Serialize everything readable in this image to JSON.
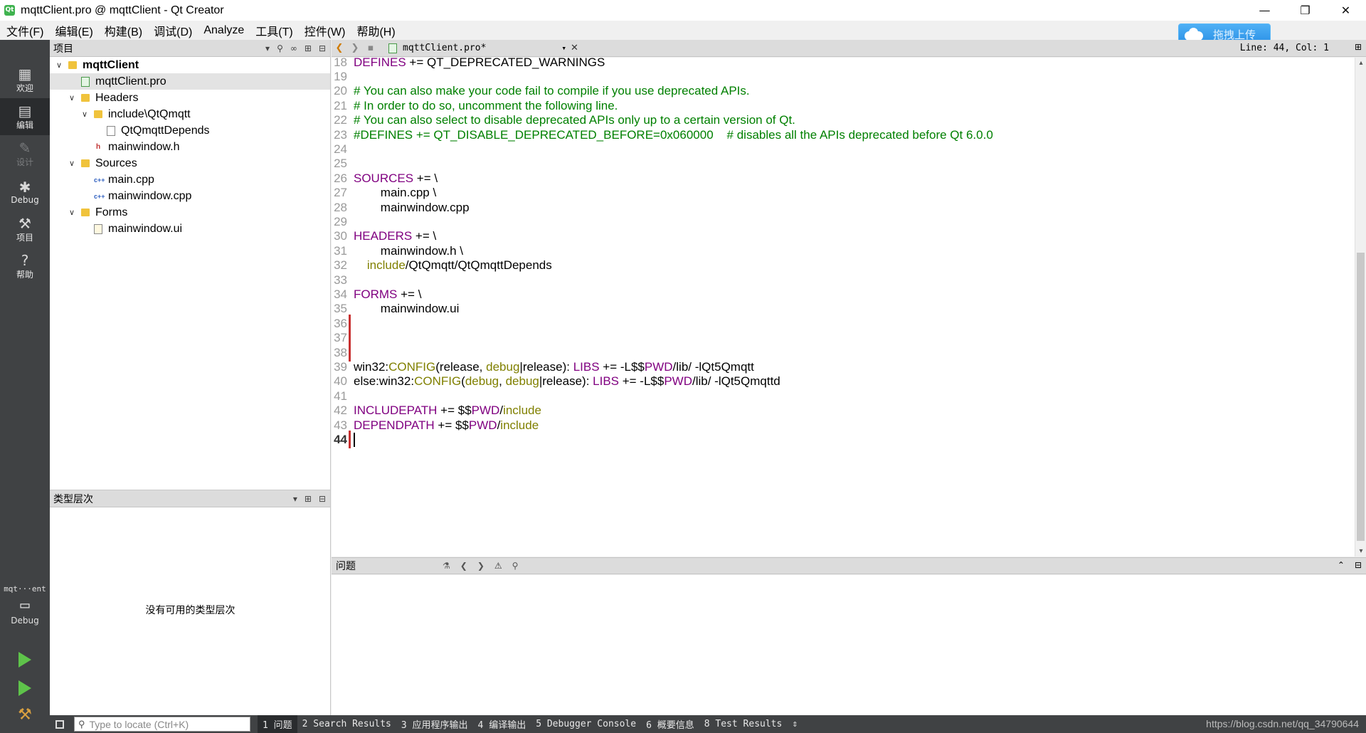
{
  "window": {
    "title": "mqttClient.pro @ mqttClient - Qt Creator",
    "app_icon": "qt-creator-icon",
    "minimize": "—",
    "restore": "❐",
    "close": "✕"
  },
  "menu": [
    "文件(F)",
    "编辑(E)",
    "构建(B)",
    "调试(D)",
    "Analyze",
    "工具(T)",
    "控件(W)",
    "帮助(H)"
  ],
  "upload_button": {
    "label": "拖拽上传",
    "icon": "cloud-icon"
  },
  "modes": {
    "welcome": "欢迎",
    "edit": "编辑",
    "design": "设计",
    "debug": "Debug",
    "projects": "项目",
    "help": "帮助"
  },
  "kit": {
    "project": "mqt···ent",
    "config": "Debug"
  },
  "project_pane": {
    "title": "项目",
    "tree": [
      {
        "label": "mqttClient",
        "level": 0,
        "expand": "v",
        "icon": "project-folder",
        "bold": true
      },
      {
        "label": "mqttClient.pro",
        "level": 1,
        "expand": "",
        "icon": "pro-file",
        "selected": true
      },
      {
        "label": "Headers",
        "level": 1,
        "expand": "v",
        "icon": "folder"
      },
      {
        "label": "include\\QtQmqtt",
        "level": 2,
        "expand": "v",
        "icon": "folder"
      },
      {
        "label": "QtQmqttDepends",
        "level": 3,
        "expand": "",
        "icon": "file"
      },
      {
        "label": "mainwindow.h",
        "level": 2,
        "expand": "",
        "icon": "header-file"
      },
      {
        "label": "Sources",
        "level": 1,
        "expand": "v",
        "icon": "folder"
      },
      {
        "label": "main.cpp",
        "level": 2,
        "expand": "",
        "icon": "cpp-file"
      },
      {
        "label": "mainwindow.cpp",
        "level": 2,
        "expand": "",
        "icon": "cpp-file"
      },
      {
        "label": "Forms",
        "level": 1,
        "expand": "v",
        "icon": "folder"
      },
      {
        "label": "mainwindow.ui",
        "level": 2,
        "expand": "",
        "icon": "ui-file"
      }
    ]
  },
  "hierarchy_pane": {
    "title": "类型层次",
    "empty_text": "没有可用的类型层次"
  },
  "editor": {
    "document": "mqttClient.pro*",
    "cursor_info": "Line: 44, Col: 1",
    "lines": [
      {
        "n": "18",
        "parts": [
          [
            "var",
            "DEFINES"
          ],
          [
            "txt",
            " += QT_DEPRECATED_WARNINGS"
          ]
        ]
      },
      {
        "n": "19",
        "parts": []
      },
      {
        "n": "20",
        "parts": [
          [
            "comment",
            "# You can also make your code fail to compile if you use deprecated APIs."
          ]
        ]
      },
      {
        "n": "21",
        "parts": [
          [
            "comment",
            "# In order to do so, uncomment the following line."
          ]
        ]
      },
      {
        "n": "22",
        "parts": [
          [
            "comment",
            "# You can also select to disable deprecated APIs only up to a certain version of Qt."
          ]
        ]
      },
      {
        "n": "23",
        "parts": [
          [
            "comment",
            "#DEFINES += QT_DISABLE_DEPRECATED_BEFORE=0x060000    # disables all the APIs deprecated before Qt 6.0.0"
          ]
        ]
      },
      {
        "n": "24",
        "parts": []
      },
      {
        "n": "25",
        "parts": []
      },
      {
        "n": "26",
        "parts": [
          [
            "var",
            "SOURCES"
          ],
          [
            "txt",
            " += \\"
          ]
        ]
      },
      {
        "n": "27",
        "parts": [
          [
            "txt",
            "        main.cpp \\"
          ]
        ]
      },
      {
        "n": "28",
        "parts": [
          [
            "txt",
            "        mainwindow.cpp"
          ]
        ]
      },
      {
        "n": "29",
        "parts": []
      },
      {
        "n": "30",
        "parts": [
          [
            "var",
            "HEADERS"
          ],
          [
            "txt",
            " += \\"
          ]
        ]
      },
      {
        "n": "31",
        "parts": [
          [
            "txt",
            "        mainwindow.h \\"
          ]
        ]
      },
      {
        "n": "32",
        "parts": [
          [
            "txt",
            "    "
          ],
          [
            "fn",
            "include"
          ],
          [
            "txt",
            "/QtQmqtt/QtQmqttDepends"
          ]
        ]
      },
      {
        "n": "33",
        "parts": []
      },
      {
        "n": "34",
        "parts": [
          [
            "var",
            "FORMS"
          ],
          [
            "txt",
            " += \\"
          ]
        ]
      },
      {
        "n": "35",
        "parts": [
          [
            "txt",
            "        mainwindow.ui"
          ]
        ]
      },
      {
        "n": "36",
        "parts": [],
        "modified": true
      },
      {
        "n": "37",
        "parts": [],
        "modified": true
      },
      {
        "n": "38",
        "parts": [],
        "modified": true
      },
      {
        "n": "39",
        "parts": [
          [
            "txt",
            "win32:"
          ],
          [
            "fn",
            "CONFIG"
          ],
          [
            "txt",
            "(release, "
          ],
          [
            "fn",
            "debug"
          ],
          [
            "txt",
            "|release): "
          ],
          [
            "var",
            "LIBS"
          ],
          [
            "txt",
            " += -L$$"
          ],
          [
            "var",
            "PWD"
          ],
          [
            "txt",
            "/lib/ -lQt5Qmqtt"
          ]
        ]
      },
      {
        "n": "40",
        "parts": [
          [
            "txt",
            "else:win32:"
          ],
          [
            "fn",
            "CONFIG"
          ],
          [
            "txt",
            "("
          ],
          [
            "fn",
            "debug"
          ],
          [
            "txt",
            ", "
          ],
          [
            "fn",
            "debug"
          ],
          [
            "txt",
            "|release): "
          ],
          [
            "var",
            "LIBS"
          ],
          [
            "txt",
            " += -L$$"
          ],
          [
            "var",
            "PWD"
          ],
          [
            "txt",
            "/lib/ -lQt5Qmqttd"
          ]
        ]
      },
      {
        "n": "41",
        "parts": []
      },
      {
        "n": "42",
        "parts": [
          [
            "var",
            "INCLUDEPATH"
          ],
          [
            "txt",
            " += $$"
          ],
          [
            "var",
            "PWD"
          ],
          [
            "txt",
            "/"
          ],
          [
            "fn",
            "include"
          ]
        ]
      },
      {
        "n": "43",
        "parts": [
          [
            "var",
            "DEPENDPATH"
          ],
          [
            "txt",
            " += $$"
          ],
          [
            "var",
            "PWD"
          ],
          [
            "txt",
            "/"
          ],
          [
            "fn",
            "include"
          ]
        ]
      },
      {
        "n": "44",
        "parts": [],
        "current": true,
        "modified": true
      }
    ]
  },
  "issues_pane": {
    "title": "问题"
  },
  "statusbar": {
    "locator_placeholder": "Type to locate (Ctrl+K)",
    "tabs": [
      "1 问题",
      "2 Search Results",
      "3 应用程序输出",
      "4 编译输出",
      "5 Debugger Console",
      "6 概要信息",
      "8 Test Results"
    ],
    "more": "⇕"
  },
  "watermark": "https://blog.csdn.net/qq_34790644",
  "colors": {
    "mode_bar": "#404244",
    "comment": "#008000",
    "variable": "#800080",
    "function": "#808000",
    "modified_marker": "#c83030",
    "run_green": "#5ec34a"
  }
}
